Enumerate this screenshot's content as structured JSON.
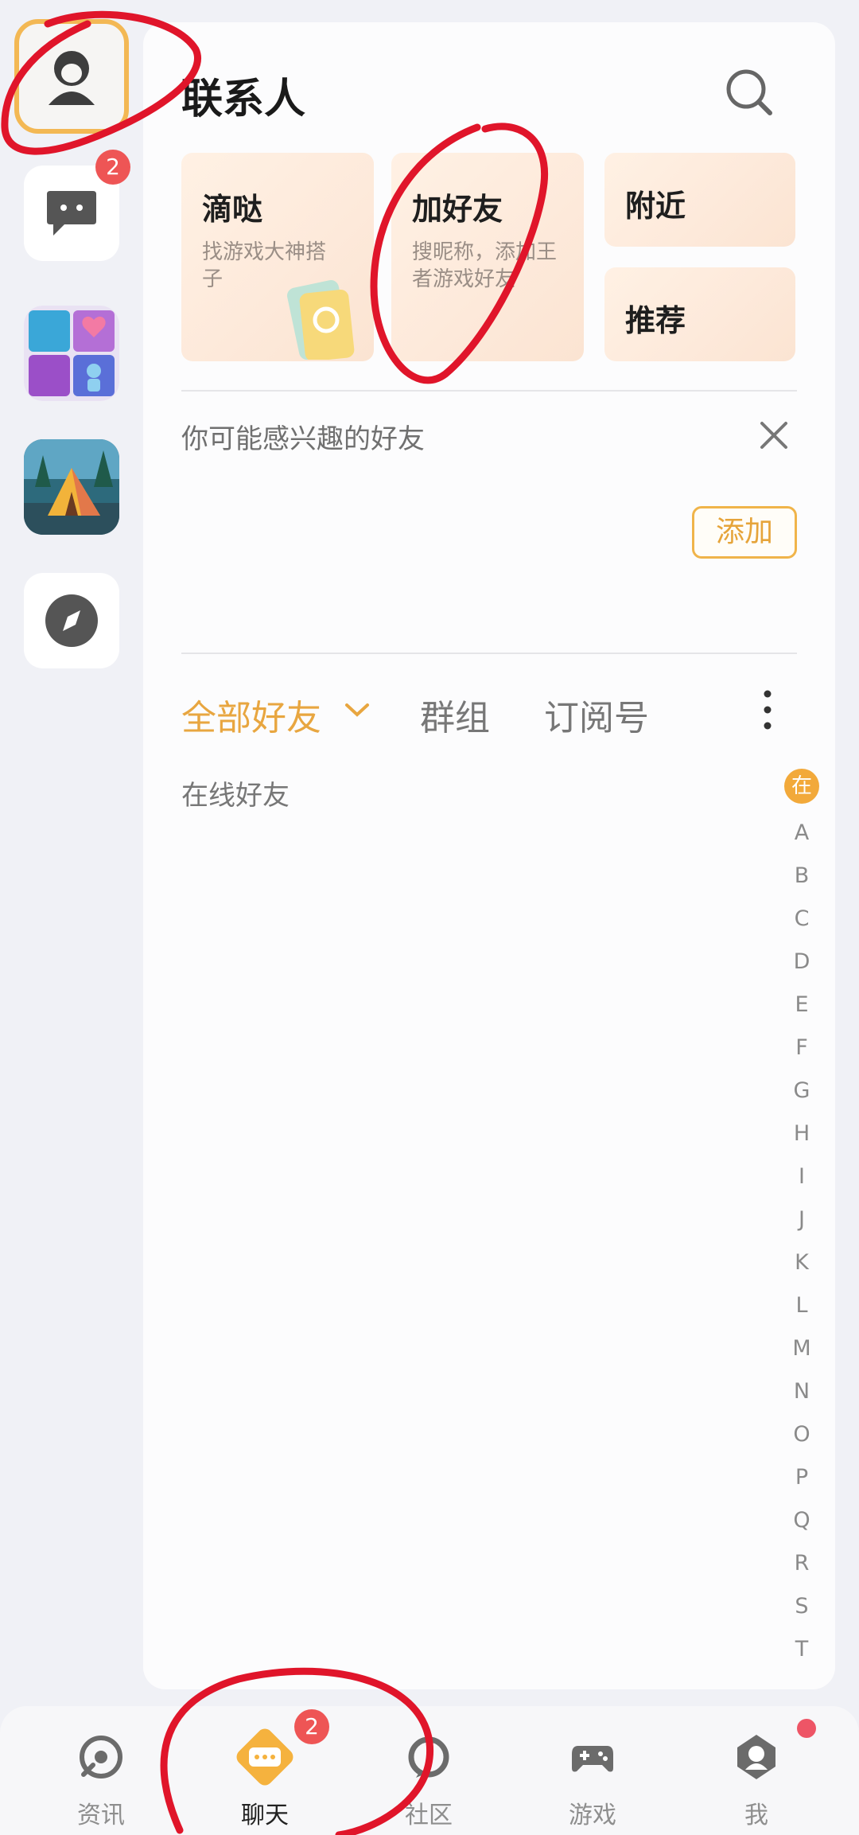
{
  "rail": {
    "contacts": {
      "icon": "person-icon"
    },
    "chat": {
      "icon": "chat-bubble-icon",
      "badge": "2"
    },
    "game_apps": [
      {
        "name": "puzzle-game-app-icon"
      },
      {
        "name": "camp-game-app-icon"
      }
    ],
    "discover": {
      "icon": "compass-icon"
    }
  },
  "header": {
    "title": "联系人"
  },
  "cards": {
    "didi": {
      "title": "滴哒",
      "subtitle": "找游戏大神搭子"
    },
    "add_friend": {
      "title": "加好友",
      "subtitle": "搜昵称，添加王者游戏好友"
    },
    "nearby": {
      "title": "附近"
    },
    "recommend": {
      "title": "推荐"
    }
  },
  "suggestions": {
    "label": "你可能感兴趣的好友",
    "add_label": "添加"
  },
  "tabs": [
    {
      "label": "全部好友",
      "active": true
    },
    {
      "label": "群组"
    },
    {
      "label": "订阅号"
    }
  ],
  "online_label": "在线好友",
  "index_letters": [
    "在",
    "A",
    "B",
    "C",
    "D",
    "E",
    "F",
    "G",
    "H",
    "I",
    "J",
    "K",
    "L",
    "M",
    "N",
    "O",
    "P",
    "Q",
    "R",
    "S",
    "T"
  ],
  "bottom_nav": [
    {
      "label": "资讯",
      "icon": "news-icon"
    },
    {
      "label": "聊天",
      "icon": "chat-icon",
      "active": true,
      "badge": "2"
    },
    {
      "label": "社区",
      "icon": "community-icon"
    },
    {
      "label": "游戏",
      "icon": "gamepad-icon"
    },
    {
      "label": "我",
      "icon": "profile-icon",
      "dot": true
    }
  ],
  "colors": {
    "accent": "#e8a640",
    "badge": "#ee5555",
    "annotation": "#e0152a"
  }
}
